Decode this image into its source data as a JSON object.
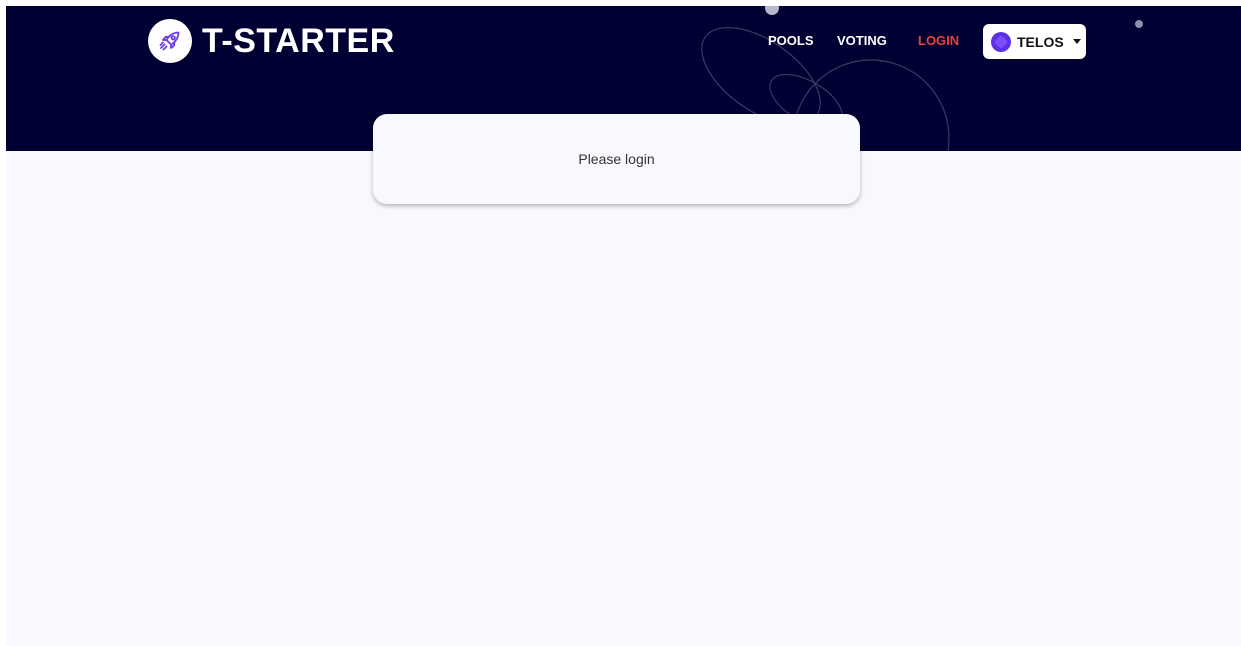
{
  "brand": {
    "name": "T-STARTER",
    "icon": "rocket-icon",
    "accent": "#6c3bea"
  },
  "nav": {
    "pools": "POOLS",
    "voting": "VOTING",
    "login": "LOGIN",
    "login_color": "#e8413a"
  },
  "network_selector": {
    "label": "TELOS",
    "icon": "telos-icon",
    "caret": "caret-down-icon"
  },
  "message": {
    "text": "Please login"
  },
  "colors": {
    "header_bg": "#000033",
    "page_bg": "#f8f9fe"
  }
}
